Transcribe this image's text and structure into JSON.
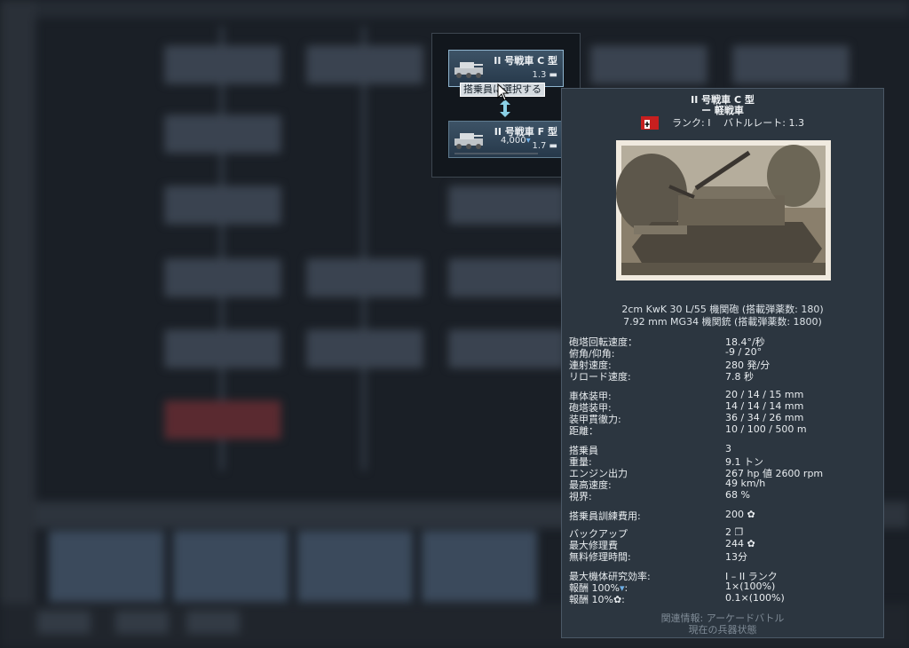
{
  "group": {
    "cards": [
      {
        "name": "II 号戦車 C 型",
        "br": "1.3",
        "cost": ""
      },
      {
        "name": "II 号戦車 F 型",
        "br": "1.7",
        "cost": "4,000"
      }
    ],
    "select_label": "搭乗員に選択する"
  },
  "tooltip": {
    "title": "II 号戦車 C 型",
    "subtitle": "ー 軽戦車",
    "rank_line": "ランク: I　 バトルレート: 1.3",
    "weapons": [
      "2cm KwK 30 L/55 機関砲 (搭載弾薬数: 180)",
      "7.92 mm MG34 機関銃 (搭載弾薬数: 1800)"
    ],
    "stats": [
      {
        "k": "砲塔回転速度：",
        "v": "18.4°/秒"
      },
      {
        "k": "俯角/仰角:",
        "v": "-9 / 20°"
      },
      {
        "k": "連射速度:",
        "v": "280 発/分"
      },
      {
        "k": "リロード速度:",
        "v": "7.8 秒"
      },
      {
        "k": "車体装甲:",
        "v": "20 / 14 / 15 mm"
      },
      {
        "k": "砲塔装甲:",
        "v": "14 / 14 / 14 mm"
      },
      {
        "k": "装甲貫徹力:",
        "v": "36 / 34 / 26 mm"
      },
      {
        "k": "距離：",
        "v": "10 / 100 / 500 m"
      },
      {
        "k": "搭乗員",
        "v": "3"
      },
      {
        "k": "重量:",
        "v": "9.1 トン"
      },
      {
        "k": "エンジン出力",
        "v": "267 hp 値 2600 rpm"
      },
      {
        "k": "最高速度:",
        "v": "49 km/h"
      },
      {
        "k": "視界:",
        "v": "68 %"
      },
      {
        "k": "搭乗員訓練費用:",
        "v": "200"
      },
      {
        "k": "バックアップ",
        "v": "2"
      },
      {
        "k": "最大修理費",
        "v": "244"
      },
      {
        "k": "無料修理時間:",
        "v": "13分"
      },
      {
        "k": "最大機体研究効率:",
        "v": "I – II ランク"
      },
      {
        "k": "報酬 100%",
        "v": "1×(100%)"
      },
      {
        "k": "報酬 10%",
        "v": "0.1×(100%)"
      }
    ],
    "footer": [
      "関連情報: アーケードバトル",
      "現在の兵器状態"
    ]
  },
  "colors": {
    "accent": "#5f7b8f",
    "tooltip_bg": "#2c3640",
    "flag": "#c81f1f"
  }
}
